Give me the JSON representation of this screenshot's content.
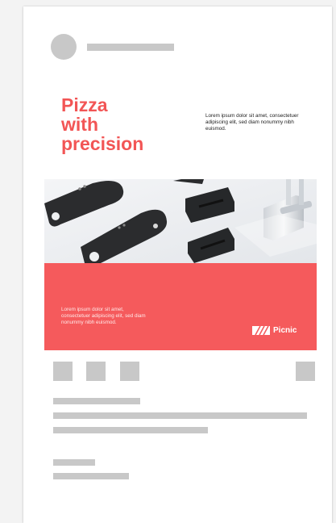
{
  "ad": {
    "headline": "Pizza\nwith\nprecision",
    "body_top": "Lorem ipsum dolor sit amet, consectetuer adipiscing elit, sed diam nonummy nibh euismod.",
    "body_bottom": "Lorem ipsum dolor sit amet, consectetuer adipiscing elit, sed diam nonummy nibh euismod.",
    "brand": "Picnic",
    "photo_icon": "product-photo-pizza-cutter-parts"
  },
  "colors": {
    "accent": "#f25555",
    "banner": "#f55a5c",
    "placeholder": "#c8c8c8"
  },
  "post": {
    "actions": [
      "action-1",
      "action-2",
      "action-3"
    ],
    "bookmark_icon": "bookmark-placeholder-icon"
  }
}
